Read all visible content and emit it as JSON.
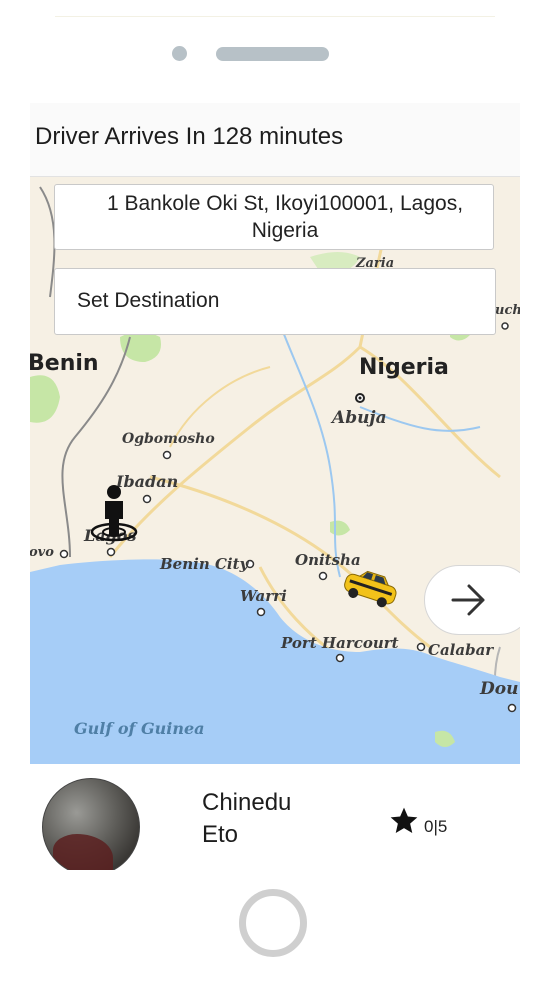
{
  "header": {
    "title": "Driver Arrives In 128 minutes"
  },
  "trip": {
    "origin": "1 Bankole Oki St, Ikoyi100001, Lagos, Nigeria",
    "destination_placeholder": "Set Destination"
  },
  "map": {
    "labels": {
      "nigeria": "Nigeria",
      "benin": "Benin",
      "abuja": "Abuja",
      "zaria": "Zaria",
      "ogbomosho": "Ogbomosho",
      "ibadan": "Ibadan",
      "lagos": "Lagos",
      "porto_novo": "ovo",
      "benin_city": "Benin City",
      "onitsha": "Onitsha",
      "warri": "Warri",
      "port_harcourt": "Port Harcourt",
      "calabar": "Calabar",
      "douala": "Dou",
      "kaduna": "uch",
      "gulf": "Gulf of Guinea"
    },
    "colors": {
      "land": "#f6f0e4",
      "sea": "#a6cdf7",
      "green": "#c6e6a6",
      "roads": "#f2d99a"
    }
  },
  "driver": {
    "first_name": "Chinedu",
    "last_name": "Eto",
    "rating": "0|5"
  },
  "icons": {
    "next": "arrow-right-icon",
    "star": "star-icon",
    "person": "person-marker-icon",
    "car": "taxi-car-icon"
  }
}
